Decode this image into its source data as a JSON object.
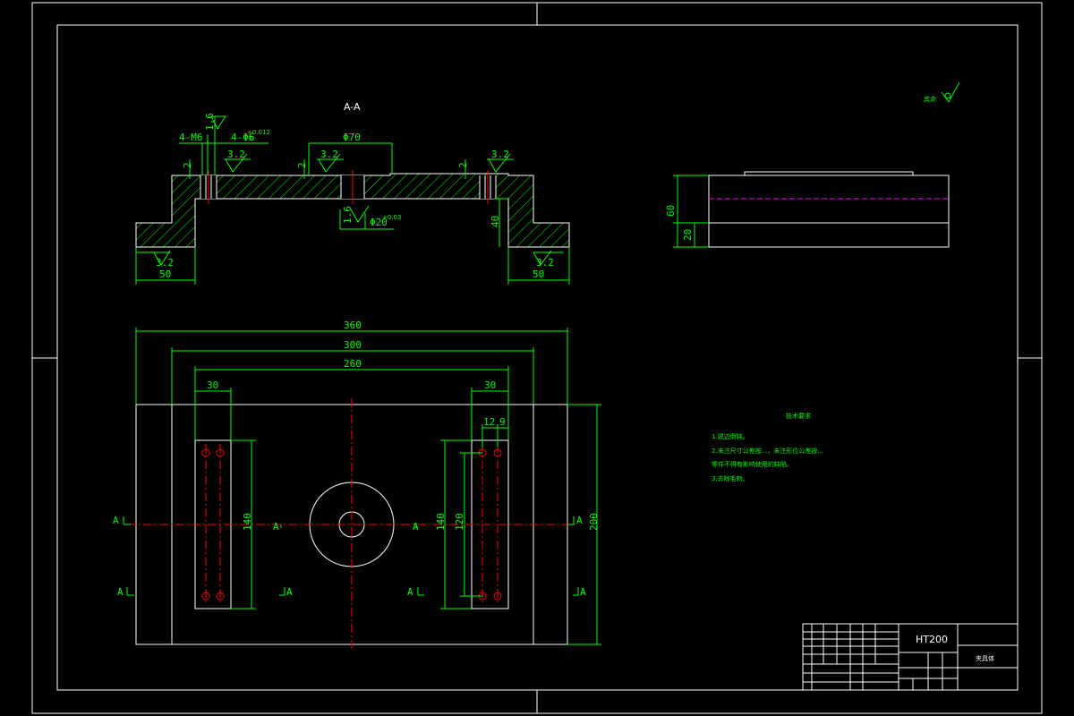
{
  "section_label": "A-A",
  "section_dims": {
    "m6": "4-M6",
    "phi6": "4-Φ6",
    "phi6_tol": "+0.012",
    "phi6_tol2": "0",
    "phi70": "Φ70",
    "phi20": "Φ20",
    "phi20_tol": "+0.03",
    "d2a": "2",
    "d2b": "2",
    "d2c": "2",
    "d40": "40",
    "d50l": "50",
    "d50r": "50"
  },
  "roughness": {
    "r16a": "1.6",
    "r32a": "3.2",
    "r32b": "3.2",
    "r32c": "3.2",
    "r16b": "1.6",
    "r32d": "3.2",
    "r32e": "3.2"
  },
  "plan_dims": {
    "d360": "360",
    "d300": "300",
    "d260": "260",
    "d30l": "30",
    "d30r": "30",
    "d12": "12",
    "d9": "9",
    "d140l": "140",
    "d140r": "140",
    "d120": "120",
    "d200": "200"
  },
  "section_marks": {
    "a1": "A",
    "a2": "A",
    "a3": "A",
    "a4": "A",
    "a5": "A",
    "a6": "A",
    "a7": "A",
    "a8": "A"
  },
  "side_dims": {
    "d60": "60",
    "d20": "20"
  },
  "general_roughness": "其余",
  "notes": {
    "title": "技术要求",
    "lines": [
      "1.锐边倒钝。",
      "2.未注尺寸公差按...，未注形位公差按...",
      "零件不得有影响使用的缺陷。",
      "3.去除毛刺。"
    ]
  },
  "title_block": {
    "material": "HT200",
    "part_name": "夹具体"
  }
}
